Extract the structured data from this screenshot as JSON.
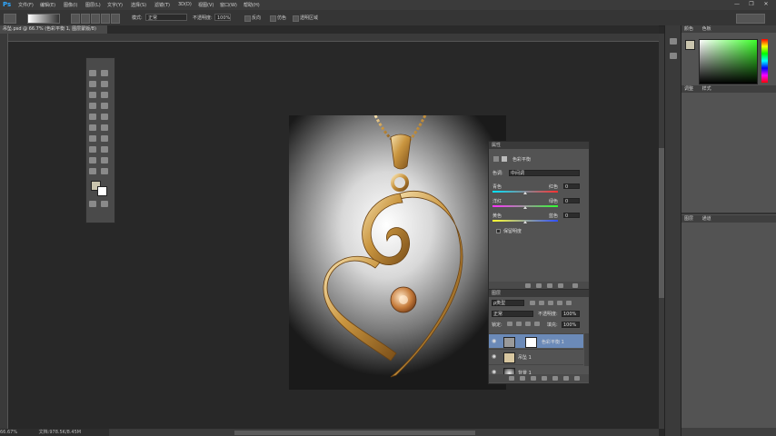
{
  "app": {
    "logo": "Ps",
    "menu": [
      "文件(F)",
      "编辑(E)",
      "图像(I)",
      "图层(L)",
      "文字(Y)",
      "选择(S)",
      "滤镜(T)",
      "3D(D)",
      "视图(V)",
      "窗口(W)",
      "帮助(H)"
    ],
    "window_buttons": [
      "—",
      "❐",
      "✕"
    ]
  },
  "options": {
    "mode_label": "模式:",
    "mode_value": "正常",
    "opacity_label": "不透明度:",
    "opacity_value": "100%",
    "reverse_label": "反向",
    "dither_label": "仿色",
    "transparency_label": "透明区域"
  },
  "document": {
    "tab_title": "吊坠.psd @ 66.7% (色彩平衡 1, 图层蒙版/8)",
    "status_zoom": "66.67%",
    "status_doc": "文档:978.5K/8.45M"
  },
  "adjustments": {
    "header": "属性",
    "title": "色彩平衡",
    "tone_label": "色调:",
    "tone_value": "中间调",
    "sliders": [
      {
        "left": "青色",
        "right": "红色",
        "value": "0",
        "level": 0.5,
        "color_left": "#00e5ff",
        "color_right": "#ff3030"
      },
      {
        "left": "洋红",
        "right": "绿色",
        "value": "0",
        "level": 0.5,
        "color_left": "#ff30ff",
        "color_right": "#30ff30"
      },
      {
        "left": "黄色",
        "right": "蓝色",
        "value": "0",
        "level": 0.5,
        "color_left": "#ffff30",
        "color_right": "#3050ff"
      }
    ],
    "preserve_label": "保留明度"
  },
  "layers_panel": {
    "header": "图层",
    "kind_label": "ρ类型",
    "blend_value": "正常",
    "opacity_label": "不透明度:",
    "opacity_value": "100%",
    "lock_label": "锁定:",
    "fill_label": "填充:",
    "fill_value": "100%",
    "layers": [
      {
        "name": "色彩平衡 1",
        "selected": true
      },
      {
        "name": "吊坠 1",
        "selected": false
      },
      {
        "name": "背景 1",
        "selected": false
      }
    ]
  },
  "right_dock": {
    "color_tabs": [
      "颜色",
      "色板"
    ],
    "adjust_tabs": [
      "调整",
      "样式"
    ],
    "layer_tabs": [
      "图层",
      "通道"
    ]
  },
  "colors": {
    "accent": "#30a8ff",
    "selected_layer": "#6b8ab8",
    "gold": "#c9953f"
  }
}
